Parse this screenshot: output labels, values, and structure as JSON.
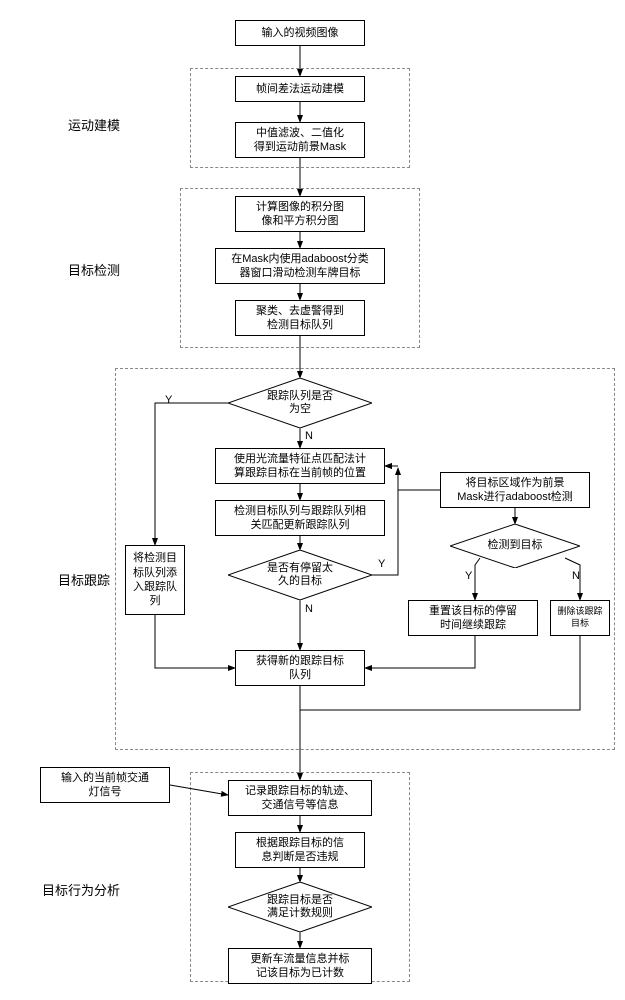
{
  "sections": {
    "motion_modeling": "运动建模",
    "object_detection": "目标检测",
    "object_tracking": "目标跟踪",
    "behavior_analysis": "目标行为分析"
  },
  "nodes": {
    "input_video": "输入的视频图像",
    "frame_diff": "帧间差法运动建模",
    "median_bin": "中值滤波、二值化\n得到运动前景Mask",
    "integral": "计算图像的积分图\n像和平方积分图",
    "adaboost_detect": "在Mask内使用adaboost分类\n器窗口滑动检测车牌目标",
    "cluster": "聚类、去虚警得到\n检测目标队列",
    "q_empty": "跟踪队列是否\n为空",
    "add_to_track": "将检测目\n标队列添\n入跟踪队\n列",
    "optflow": "使用光流量特征点匹配法计\n算跟踪目标在当前帧的位置",
    "match_update": "检测目标队列与跟踪队列相\n关匹配更新跟踪队列",
    "stay_long": "是否有停留太\n久的目标",
    "fg_adaboost": "将目标区域作为前景\nMask进行adaboost检测",
    "detected": "检测到目标",
    "reset_stay": "重置该目标的停留\n时间继续跟踪",
    "delete_target": "删除该跟踪目标",
    "new_queue": "获得新的跟踪目标\n队列",
    "input_signal": "输入的当前帧交通\n灯信号",
    "record": "记录跟踪目标的轨迹、\n交通信号等信息",
    "judge_violate": "根据跟踪目标的信\n息判断是否违规",
    "count_rule": "跟踪目标是否\n满足计数规则",
    "update_flow": "更新车流量信息并标\n记该目标为已计数"
  },
  "edges": {
    "Y": "Y",
    "N": "N"
  },
  "chart_data": {
    "type": "flowchart",
    "nodes": [
      {
        "id": "input_video",
        "type": "process",
        "label": "输入的视频图像"
      },
      {
        "id": "frame_diff",
        "type": "process",
        "label": "帧间差法运动建模",
        "group": "motion_modeling"
      },
      {
        "id": "median_bin",
        "type": "process",
        "label": "中值滤波、二值化得到运动前景Mask",
        "group": "motion_modeling"
      },
      {
        "id": "integral",
        "type": "process",
        "label": "计算图像的积分图像和平方积分图",
        "group": "object_detection"
      },
      {
        "id": "adaboost_detect",
        "type": "process",
        "label": "在Mask内使用adaboost分类器窗口滑动检测车牌目标",
        "group": "object_detection"
      },
      {
        "id": "cluster",
        "type": "process",
        "label": "聚类、去虚警得到检测目标队列",
        "group": "object_detection"
      },
      {
        "id": "q_empty",
        "type": "decision",
        "label": "跟踪队列是否为空",
        "group": "object_tracking"
      },
      {
        "id": "add_to_track",
        "type": "process",
        "label": "将检测目标队列添入跟踪队列",
        "group": "object_tracking"
      },
      {
        "id": "optflow",
        "type": "process",
        "label": "使用光流量特征点匹配法计算跟踪目标在当前帧的位置",
        "group": "object_tracking"
      },
      {
        "id": "match_update",
        "type": "process",
        "label": "检测目标队列与跟踪队列相关匹配更新跟踪队列",
        "group": "object_tracking"
      },
      {
        "id": "stay_long",
        "type": "decision",
        "label": "是否有停留太久的目标",
        "group": "object_tracking"
      },
      {
        "id": "fg_adaboost",
        "type": "process",
        "label": "将目标区域作为前景Mask进行adaboost检测",
        "group": "object_tracking"
      },
      {
        "id": "detected",
        "type": "decision",
        "label": "检测到目标",
        "group": "object_tracking"
      },
      {
        "id": "reset_stay",
        "type": "process",
        "label": "重置该目标的停留时间继续跟踪",
        "group": "object_tracking"
      },
      {
        "id": "delete_target",
        "type": "process",
        "label": "删除该跟踪目标",
        "group": "object_tracking"
      },
      {
        "id": "new_queue",
        "type": "process",
        "label": "获得新的跟踪目标队列",
        "group": "object_tracking"
      },
      {
        "id": "input_signal",
        "type": "process",
        "label": "输入的当前帧交通灯信号"
      },
      {
        "id": "record",
        "type": "process",
        "label": "记录跟踪目标的轨迹、交通信号等信息",
        "group": "behavior_analysis"
      },
      {
        "id": "judge_violate",
        "type": "process",
        "label": "根据跟踪目标的信息判断是否违规",
        "group": "behavior_analysis"
      },
      {
        "id": "count_rule",
        "type": "decision",
        "label": "跟踪目标是否满足计数规则",
        "group": "behavior_analysis"
      },
      {
        "id": "update_flow",
        "type": "process",
        "label": "更新车流量信息并标记该目标为已计数",
        "group": "behavior_analysis"
      }
    ],
    "edges": [
      {
        "from": "input_video",
        "to": "frame_diff"
      },
      {
        "from": "frame_diff",
        "to": "median_bin"
      },
      {
        "from": "median_bin",
        "to": "integral"
      },
      {
        "from": "integral",
        "to": "adaboost_detect"
      },
      {
        "from": "adaboost_detect",
        "to": "cluster"
      },
      {
        "from": "cluster",
        "to": "q_empty"
      },
      {
        "from": "q_empty",
        "to": "add_to_track",
        "label": "Y"
      },
      {
        "from": "q_empty",
        "to": "optflow",
        "label": "N"
      },
      {
        "from": "optflow",
        "to": "match_update"
      },
      {
        "from": "match_update",
        "to": "stay_long"
      },
      {
        "from": "stay_long",
        "to": "new_queue",
        "label": "N"
      },
      {
        "from": "stay_long",
        "to": "fg_adaboost",
        "label": "Y"
      },
      {
        "from": "fg_adaboost",
        "to": "detected"
      },
      {
        "from": "detected",
        "to": "reset_stay",
        "label": "Y"
      },
      {
        "from": "detected",
        "to": "delete_target",
        "label": "N"
      },
      {
        "from": "reset_stay",
        "to": "new_queue"
      },
      {
        "from": "delete_target",
        "to": "new_queue"
      },
      {
        "from": "add_to_track",
        "to": "new_queue"
      },
      {
        "from": "reset_stay",
        "to": "optflow"
      },
      {
        "from": "new_queue",
        "to": "record"
      },
      {
        "from": "input_signal",
        "to": "record"
      },
      {
        "from": "record",
        "to": "judge_violate"
      },
      {
        "from": "judge_violate",
        "to": "count_rule"
      },
      {
        "from": "count_rule",
        "to": "update_flow"
      }
    ],
    "groups": {
      "motion_modeling": "运动建模",
      "object_detection": "目标检测",
      "object_tracking": "目标跟踪",
      "behavior_analysis": "目标行为分析"
    }
  }
}
